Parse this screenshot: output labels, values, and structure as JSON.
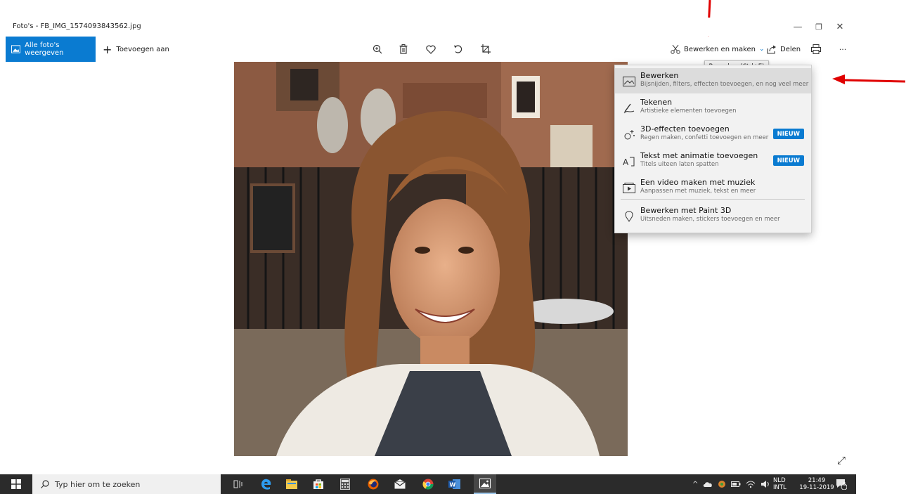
{
  "window": {
    "title": "Foto's - FB_IMG_1574093843562.jpg",
    "minimize": "—",
    "restore": "❐",
    "close": "✕"
  },
  "toolbar": {
    "all_photos_label": "Alle foto's weergeven",
    "add_to_label": "Toevoegen aan",
    "edit_create_label": "Bewerken en maken",
    "share_label": "Delen",
    "more_label": "···"
  },
  "tooltip": {
    "text": "Bewerken (Ctrl+E)"
  },
  "menu": {
    "items": [
      {
        "title": "Bewerken",
        "subtitle": "Bijsnijden, filters, effecten toevoegen, en nog veel meer",
        "icon": "edit-photo-icon"
      },
      {
        "title": "Tekenen",
        "subtitle": "Artistieke elementen toevoegen",
        "icon": "pen-icon"
      },
      {
        "title": "3D-effecten toevoegen",
        "subtitle": "Regen maken, confetti toevoegen en meer",
        "icon": "sparkle-icon",
        "badge": "NIEUW"
      },
      {
        "title": "Tekst met animatie toevoegen",
        "subtitle": "Titels uiteen laten spatten",
        "icon": "animated-text-icon",
        "badge": "NIEUW"
      },
      {
        "title": "Een video maken met muziek",
        "subtitle": "Aanpassen met muziek, tekst en meer",
        "icon": "video-icon"
      },
      {
        "title": "Bewerken met Paint 3D",
        "subtitle": "Uitsneden maken, stickers toevoegen en meer",
        "icon": "paint3d-icon"
      }
    ]
  },
  "taskbar": {
    "search_placeholder": "Typ hier om te zoeken",
    "lang_line1": "NLD",
    "lang_line2": "INTL",
    "time": "21:49",
    "date": "19-11-2019",
    "notifications": "6"
  },
  "colors": {
    "accent": "#0a7bd1",
    "arrow": "#e00000",
    "taskbar": "#2b2b2b"
  }
}
